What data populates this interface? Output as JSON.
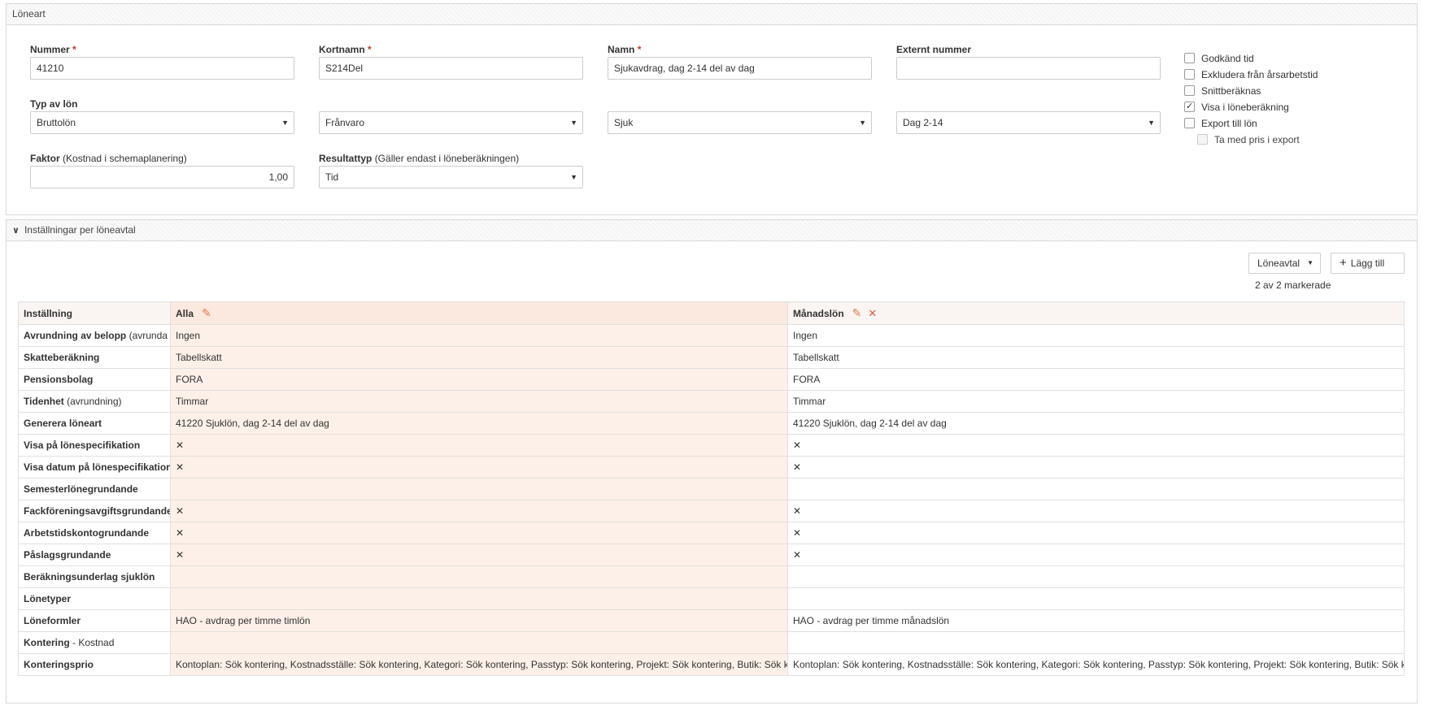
{
  "panel1": {
    "title": "Löneart",
    "nummer": {
      "label": "Nummer",
      "value": "41210"
    },
    "kortnamn": {
      "label": "Kortnamn",
      "value": "S214Del"
    },
    "namn": {
      "label": "Namn",
      "value": "Sjukavdrag, dag 2-14 del av dag"
    },
    "externt": {
      "label": "Externt nummer",
      "value": ""
    },
    "typ_label": "Typ av lön",
    "typ_values": [
      "Bruttolön",
      "Frånvaro",
      "Sjuk",
      "Dag 2-14"
    ],
    "faktor": {
      "label": "Faktor",
      "hint": "(Kostnad i schemaplanering)",
      "value": "1,00"
    },
    "resultattyp": {
      "label": "Resultattyp",
      "hint": "(Gäller endast i löneberäkningen)",
      "value": "Tid"
    },
    "required_mark": "*",
    "checkboxes": [
      {
        "label": "Godkänd tid",
        "checked": false
      },
      {
        "label": "Exkludera från årsarbetstid",
        "checked": false
      },
      {
        "label": "Snittberäknas",
        "checked": false
      },
      {
        "label": "Visa i löneberäkning",
        "checked": true
      },
      {
        "label": "Export till lön",
        "checked": false
      },
      {
        "label": "Ta med pris i export",
        "checked": false
      }
    ]
  },
  "panel2": {
    "title": "Inställningar per löneavtal",
    "loneavtal_button": "Löneavtal",
    "add_button": "Lägg till",
    "selection_info": "2 av 2 markerade",
    "header": {
      "setting": "Inställning",
      "col1": "Alla",
      "col2": "Månadslön"
    },
    "rows": [
      {
        "label": "Avrundning av belopp",
        "hint": "(avrunda till)",
        "v1": "Ingen",
        "v2": "Ingen"
      },
      {
        "label": "Skatteberäkning",
        "hint": "",
        "v1": "Tabellskatt",
        "v2": "Tabellskatt"
      },
      {
        "label": "Pensionsbolag",
        "hint": "",
        "v1": "FORA",
        "v2": "FORA"
      },
      {
        "label": "Tidenhet",
        "hint": "(avrundning)",
        "v1": "Timmar",
        "v2": "Timmar"
      },
      {
        "label": "Generera löneart",
        "hint": "",
        "v1": "41220 Sjuklön, dag 2-14 del av dag",
        "v2": "41220 Sjuklön, dag 2-14 del av dag"
      },
      {
        "label": "Visa på lönespecifikation",
        "hint": "",
        "v1": "✕",
        "v2": "✕"
      },
      {
        "label": "Visa datum på lönespecifikation",
        "hint": "",
        "v1": "✕",
        "v2": "✕"
      },
      {
        "label": "Semesterlönegrundande",
        "hint": "",
        "v1": "",
        "v2": ""
      },
      {
        "label": "Fackföreningsavgiftsgrundande",
        "hint": "",
        "v1": "✕",
        "v2": "✕"
      },
      {
        "label": "Arbetstidskontogrundande",
        "hint": "",
        "v1": "✕",
        "v2": "✕"
      },
      {
        "label": "Påslagsgrundande",
        "hint": "",
        "v1": "✕",
        "v2": "✕"
      },
      {
        "label": "Beräkningsunderlag sjuklön",
        "hint": "",
        "v1": "",
        "v2": ""
      },
      {
        "label": "Lönetyper",
        "hint": "",
        "v1": "",
        "v2": ""
      },
      {
        "label": "Löneformler",
        "hint": "",
        "v1": "HAO - avdrag per timme timlön",
        "v2": "HAO - avdrag per timme månadslön"
      },
      {
        "label": "Kontering",
        "hint": "- Kostnad",
        "v1": "",
        "v2": ""
      },
      {
        "label": "Konteringsprio",
        "hint": "",
        "v1": "Kontoplan: Sök kontering, Kostnadsställe: Sök kontering, Kategori: Sök kontering, Passtyp: Sök kontering, Projekt: Sök kontering, Butik: Sök kontering",
        "v2": "Kontoplan: Sök kontering, Kostnadsställe: Sök kontering, Kategori: Sök kontering, Passtyp: Sök kontering, Projekt: Sök kontering, Butik: Sök kontering"
      }
    ]
  }
}
